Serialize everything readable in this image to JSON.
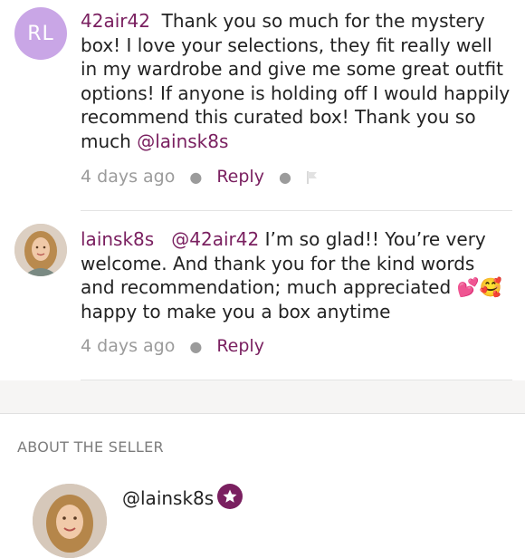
{
  "comments": [
    {
      "initials": "RL",
      "username": "42air42",
      "body": "Thank you so much for the mystery box! I love your selections, they fit really well in my wardrobe and give me some great outfit options! If anyone is holding off I would happily recommend this curated box! Thank you so much",
      "mention": "@lainsk8s",
      "time": "4 days ago",
      "reply_label": "Reply"
    },
    {
      "username": "lainsk8s",
      "mention": "@42air42",
      "body": "I’m so glad!! You’re very welcome. And thank you for the kind words and recommendation; much appreciated",
      "emojis": "💕🥰",
      "body_tail": "happy to make you a box anytime",
      "time": "4 days ago",
      "reply_label": "Reply"
    }
  ],
  "about": {
    "title": "ABOUT THE SELLER",
    "handle": "@lainsk8s"
  },
  "colors": {
    "accent": "#7a2060",
    "avatar_bg": "#c9a6e6"
  }
}
